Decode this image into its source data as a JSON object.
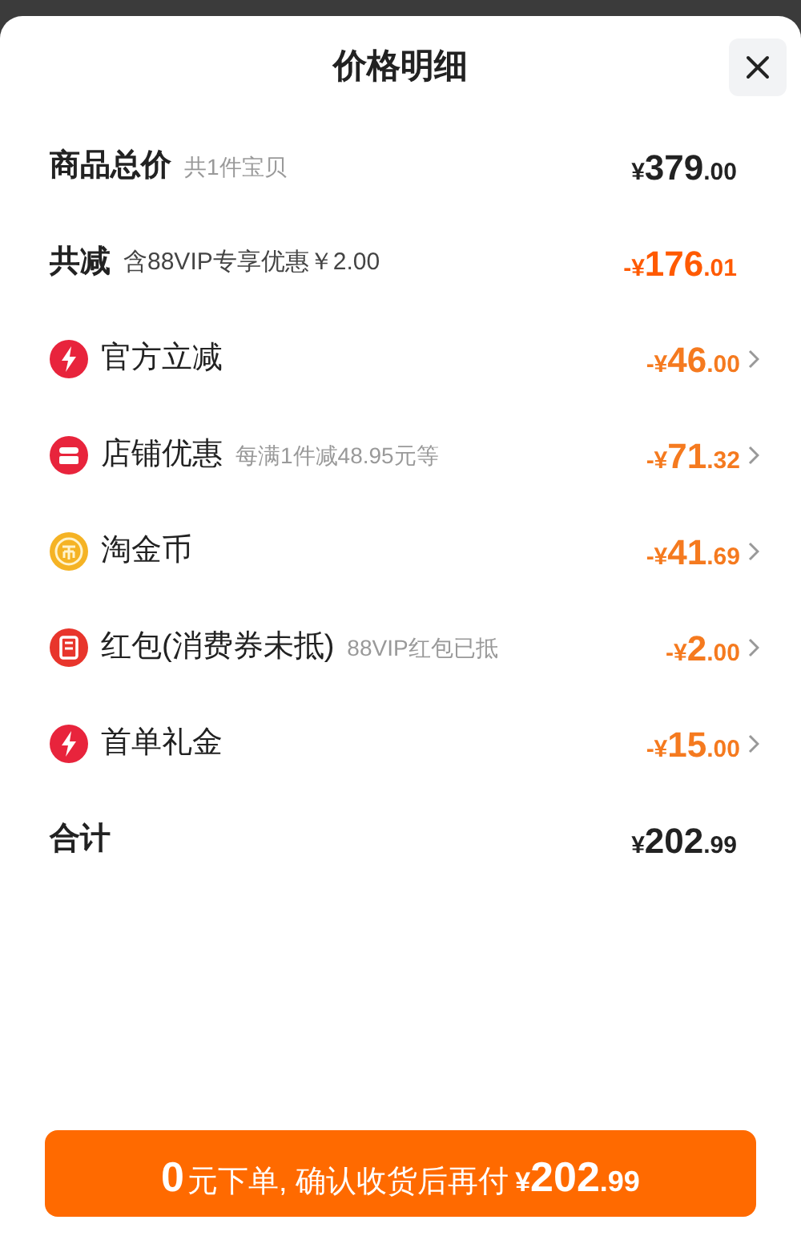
{
  "title": "价格明细",
  "rows": [
    {
      "kind": "total",
      "label": "商品总价",
      "note": "共1件宝贝",
      "currency": "¥",
      "integer": "379",
      "decimal": ".00"
    },
    {
      "kind": "discount_total",
      "label": "共减",
      "note": "含88VIP专享优惠￥2.00",
      "currency": "-¥",
      "integer": "176",
      "decimal": ".01"
    },
    {
      "kind": "bolt",
      "color": "#e8243c",
      "label": "官方立减",
      "currency": "-¥",
      "integer": "46",
      "decimal": ".00"
    },
    {
      "kind": "shop",
      "color": "#e8243c",
      "label": "店铺优惠",
      "note": "每满1件减48.95元等",
      "currency": "-¥",
      "integer": "71",
      "decimal": ".32"
    },
    {
      "kind": "coin",
      "color": "#f5b324",
      "label": "淘金币",
      "currency": "-¥",
      "integer": "41",
      "decimal": ".69"
    },
    {
      "kind": "envelope",
      "color": "#e8352c",
      "label": "红包(消费券未抵)",
      "note": "88VIP红包已抵",
      "currency": "-¥",
      "integer": "2",
      "decimal": ".00"
    },
    {
      "kind": "bolt",
      "color": "#e8243c",
      "label": "首单礼金",
      "currency": "-¥",
      "integer": "15",
      "decimal": ".00"
    },
    {
      "kind": "total",
      "label": "合计",
      "currency": "¥",
      "integer": "202",
      "decimal": ".99"
    }
  ],
  "button": {
    "lead": "0",
    "text": "元下单, 确认收货后再付",
    "currency": "¥",
    "integer": "202",
    "decimal": ".99"
  }
}
